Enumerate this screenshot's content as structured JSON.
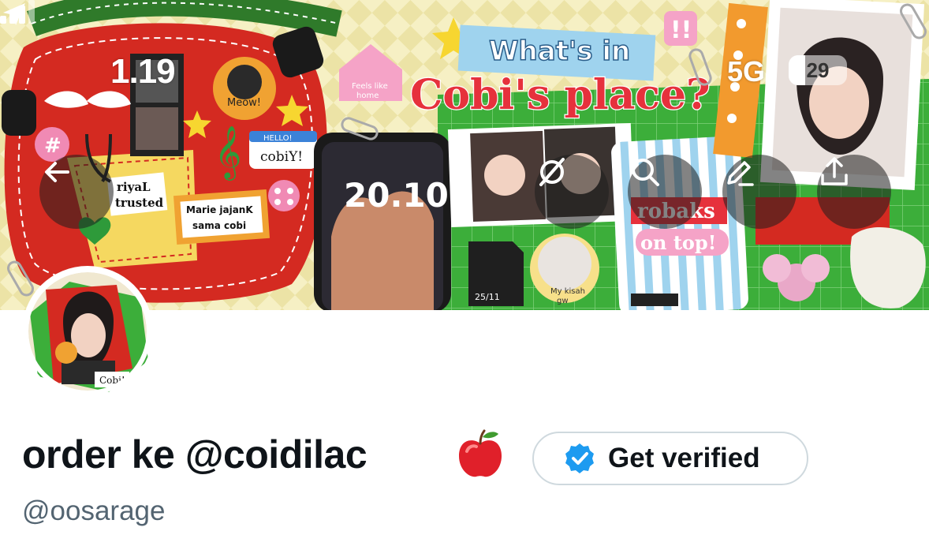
{
  "status_bar": {
    "time": "1.19",
    "network": "5G",
    "battery_level": "29",
    "battery_fraction": 0.29
  },
  "header_buttons": {
    "back": "back-arrow-icon",
    "grok": "grok-slash-icon",
    "search": "search-icon",
    "edit": "pencil-icon",
    "share": "share-upload-icon"
  },
  "banner": {
    "title_line1": "What's in",
    "title_line2": "Cobi's place?",
    "phone_time": "20.10",
    "sticker_meow": "Meow!",
    "sticker_hello": "HELLO!",
    "sticker_name": "cobiY!",
    "sticker_riyal": "riyaL",
    "sticker_trusted": "trusted",
    "sticker_marie": "Marie jajanK",
    "sticker_sama": "sama cobi",
    "sticker_feels_1": "Feels like",
    "sticker_feels_2": "home",
    "sticker_robaks": "robaks",
    "sticker_ontop": "on top!",
    "sticker_my": "My",
    "sticker_kisah": "My kisah",
    "sticker_gw": "gw",
    "sdcard_date": "25/11",
    "avatar_sticker": "Cobi!"
  },
  "profile": {
    "display_name": "order ke @coidilac",
    "name_emoji": "apple-emoji",
    "handle": "@oosarage",
    "verify_label": "Get verified",
    "verify_badge": "verified-badge-icon"
  },
  "colors": {
    "accent_blue": "#1d9bf0",
    "banner_green": "#3cae3a",
    "bag_red": "#d42a21",
    "text_primary": "#0f1419",
    "text_secondary": "#536471"
  }
}
